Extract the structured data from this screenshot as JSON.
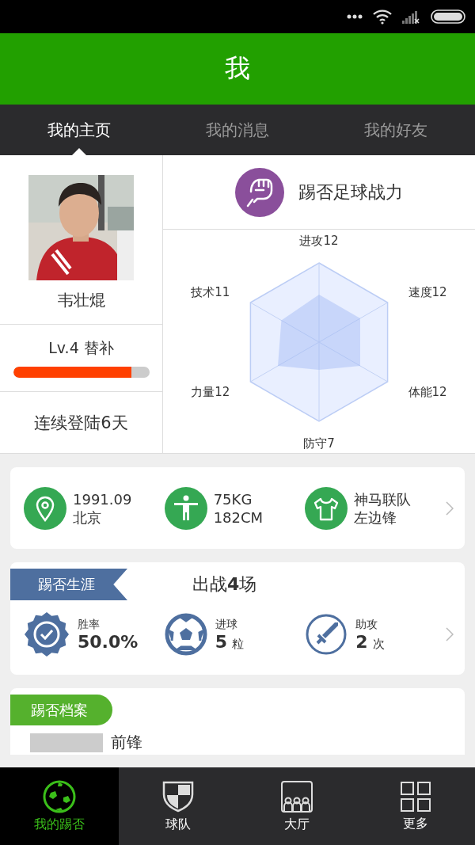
{
  "header": {
    "title": "我"
  },
  "tabs": [
    {
      "label": "我的主页",
      "selected": true
    },
    {
      "label": "我的消息",
      "selected": false
    },
    {
      "label": "我的好友",
      "selected": false
    }
  ],
  "profile": {
    "name": "韦壮焜",
    "level_label": "Lv.4 替补",
    "exp": {
      "level": 0.87
    },
    "login_streak": "连续登陆6天"
  },
  "power": {
    "title": "踢否足球战力",
    "axes": [
      {
        "label": "进攻12"
      },
      {
        "label": "速度12"
      },
      {
        "label": "体能12"
      },
      {
        "label": "防守7"
      },
      {
        "label": "力量12"
      },
      {
        "label": "技术11"
      }
    ]
  },
  "info": [
    {
      "kind": "location",
      "lines": [
        "1991.09",
        "北京"
      ]
    },
    {
      "kind": "body",
      "lines": [
        "75KG",
        "182CM"
      ]
    },
    {
      "kind": "team",
      "lines": [
        "神马联队",
        "左边锋"
      ]
    }
  ],
  "career": {
    "ribbon": "踢否生涯",
    "summary": "出战**4**场",
    "stats": [
      {
        "kind": "winrate",
        "label": "胜率",
        "value": "50.0%"
      },
      {
        "kind": "goals",
        "label": "进球",
        "value": "5",
        "unit": "粒"
      },
      {
        "kind": "assists",
        "label": "助攻",
        "value": "2",
        "unit": "次"
      }
    ]
  },
  "archive": {
    "tag": "踢否档案",
    "position": "前锋"
  },
  "bottom_nav": [
    {
      "kind": "ball",
      "label": "我的踢否",
      "selected": true
    },
    {
      "kind": "shield",
      "label": "球队",
      "selected": false
    },
    {
      "kind": "hall",
      "label": "大厅",
      "selected": false
    },
    {
      "kind": "grid",
      "label": "更多",
      "selected": false
    }
  ]
}
